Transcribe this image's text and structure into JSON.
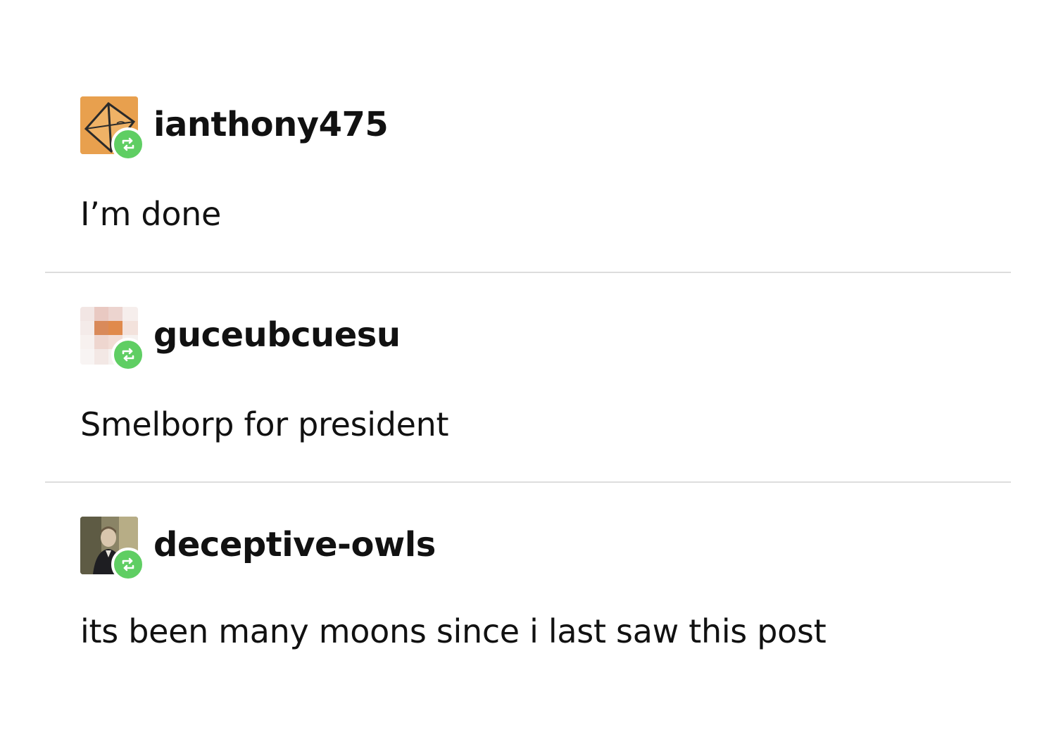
{
  "posts": [
    {
      "username": "ianthony475",
      "text": "I’m done",
      "avatar_icon": "diamond-illustration",
      "avatar_color": "#e8a04e"
    },
    {
      "username": "guceubcuesu",
      "text": "Smelborp for president",
      "avatar_icon": "pixel-blocks",
      "avatar_color": "#d98a5a"
    },
    {
      "username": "deceptive-owls",
      "text": "its been many moons since i last saw this post",
      "avatar_icon": "person-photo",
      "avatar_color": "#6b6a52"
    }
  ],
  "badge": {
    "icon": "reblog-icon",
    "color": "#5fce63"
  }
}
